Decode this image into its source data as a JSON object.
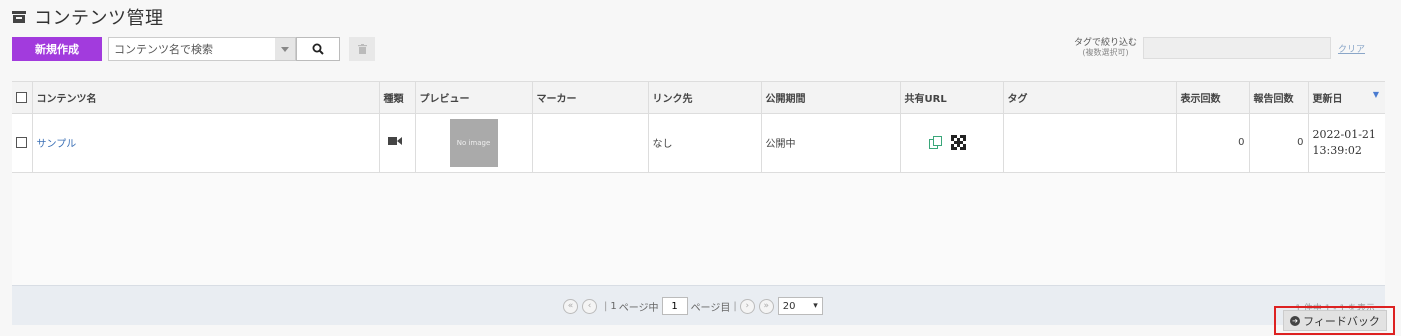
{
  "header": {
    "title": "コンテンツ管理",
    "icon": "archive-icon"
  },
  "toolbar": {
    "new_label": "新規作成",
    "new_color": "#a23bdd",
    "search_placeholder": "コンテンツ名で検索",
    "search_icon": "search-icon",
    "trash_icon": "trash-icon"
  },
  "tag_filter": {
    "label": "タグで絞り込む",
    "sublabel": "(複数選択可)",
    "clear_label": "クリア"
  },
  "table": {
    "headers": {
      "name": "コンテンツ名",
      "type": "種類",
      "preview": "プレビュー",
      "marker": "マーカー",
      "link": "リンク先",
      "period": "公開期間",
      "share": "共有URL",
      "tag": "タグ",
      "views": "表示回数",
      "reports": "報告回数",
      "updated": "更新日"
    },
    "rows": [
      {
        "name": "サンプル",
        "type_icon": "video-icon",
        "preview": "No image",
        "marker": "",
        "link": "なし",
        "period": "公開中",
        "tag": "",
        "views": "0",
        "reports": "0",
        "updated_date": "2022-01-21",
        "updated_time": "13:39:02"
      }
    ]
  },
  "pager": {
    "pages_total": "1",
    "pages_of_text": "ページ中",
    "current_page": "1",
    "page_suffix": "ページ目",
    "page_size": "20",
    "count_text": "1 件中 1 - 1 を表示"
  },
  "feedback": {
    "label": "フィードバック"
  }
}
